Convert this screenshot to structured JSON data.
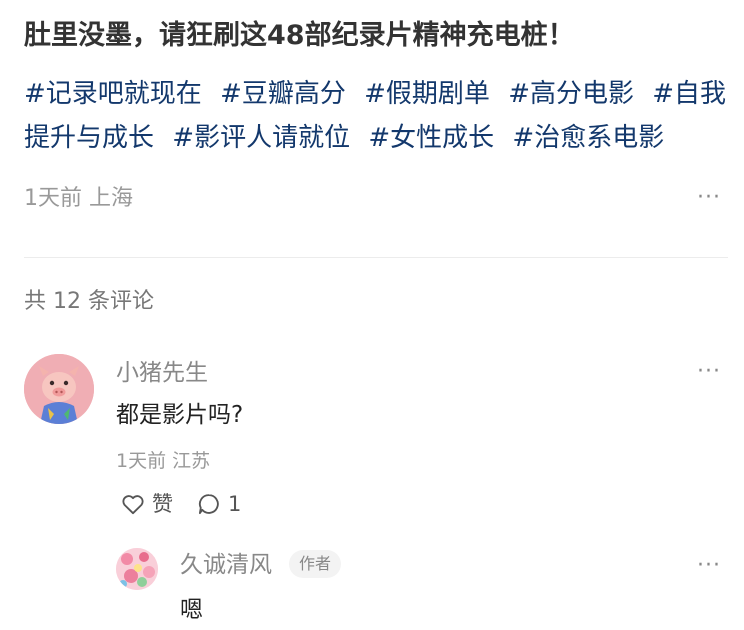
{
  "post": {
    "title": "肚里没墨，请狂刷这48部纪录片精神充电桩！",
    "tags": [
      "#记录吧就现在",
      "#豆瓣高分",
      "#假期剧单",
      "#高分电影",
      "#自我提升与成长",
      "#影评人请就位",
      "#女性成长",
      "#治愈系电影"
    ],
    "meta": "1天前 上海",
    "more": "···"
  },
  "comments": {
    "count_label": "共 12 条评论",
    "first": {
      "username": "小猪先生",
      "content": "都是影片吗?",
      "meta": "1天前 江苏",
      "like_label": "赞",
      "reply_count": "1",
      "more": "···"
    },
    "reply": {
      "username": "久诚清风",
      "badge": "作者",
      "content": "嗯",
      "more": "···"
    }
  },
  "colors": {
    "tag": "#13386c",
    "title": "#333333",
    "muted": "#999999"
  }
}
